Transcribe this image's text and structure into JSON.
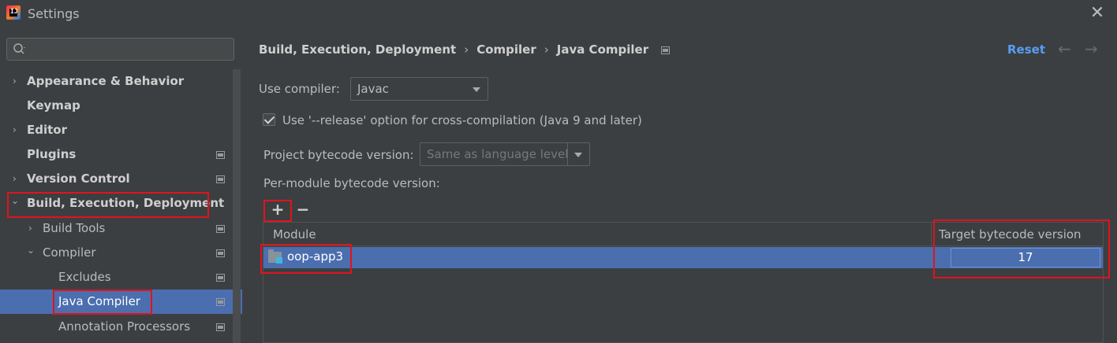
{
  "window": {
    "title": "Settings",
    "app_icon_text": "IJ",
    "close_glyph": "✕"
  },
  "search": {
    "placeholder": "",
    "value": ""
  },
  "sidebar": {
    "items": [
      {
        "label": "Appearance & Behavior",
        "chevron": "›",
        "bold": true
      },
      {
        "label": "Keymap",
        "chevron": "",
        "bold": true
      },
      {
        "label": "Editor",
        "chevron": "›",
        "bold": true
      },
      {
        "label": "Plugins",
        "chevron": "",
        "bold": true
      },
      {
        "label": "Version Control",
        "chevron": "›",
        "bold": true
      },
      {
        "label": "Build, Execution, Deployment",
        "chevron": "⌄",
        "bold": true
      },
      {
        "label": "Build Tools",
        "chevron": "›",
        "bold": false
      },
      {
        "label": "Compiler",
        "chevron": "⌄",
        "bold": false
      },
      {
        "label": "Excludes",
        "chevron": "",
        "bold": false
      },
      {
        "label": "Java Compiler",
        "chevron": "",
        "bold": false,
        "selected": true
      },
      {
        "label": "Annotation Processors",
        "chevron": "",
        "bold": false
      }
    ]
  },
  "breadcrumb": {
    "parts": [
      "Build, Execution, Deployment",
      "Compiler",
      "Java Compiler"
    ],
    "separator": "›"
  },
  "header": {
    "reset_label": "Reset",
    "back_glyph": "←",
    "forward_glyph": "→"
  },
  "form": {
    "use_compiler_label": "Use compiler:",
    "use_compiler_value": "Javac",
    "release_option_label": "Use '--release' option for cross-compilation (Java 9 and later)",
    "release_option_checked": true,
    "project_bytecode_label": "Project bytecode version:",
    "project_bytecode_value": "Same as language level",
    "per_module_label": "Per-module bytecode version:",
    "add_glyph": "+",
    "remove_glyph": "−"
  },
  "table": {
    "columns": [
      "Module",
      "Target bytecode version"
    ],
    "rows": [
      {
        "module": "oop-app3",
        "target": "17"
      }
    ]
  },
  "colors": {
    "accent": "#589df6",
    "selection": "#4b6eaf",
    "highlight_box": "#e0131e",
    "background": "#3c3f41"
  },
  "icons": {
    "search": "search-icon",
    "folder": "module-folder-icon",
    "project_level": "project-level-icon"
  }
}
